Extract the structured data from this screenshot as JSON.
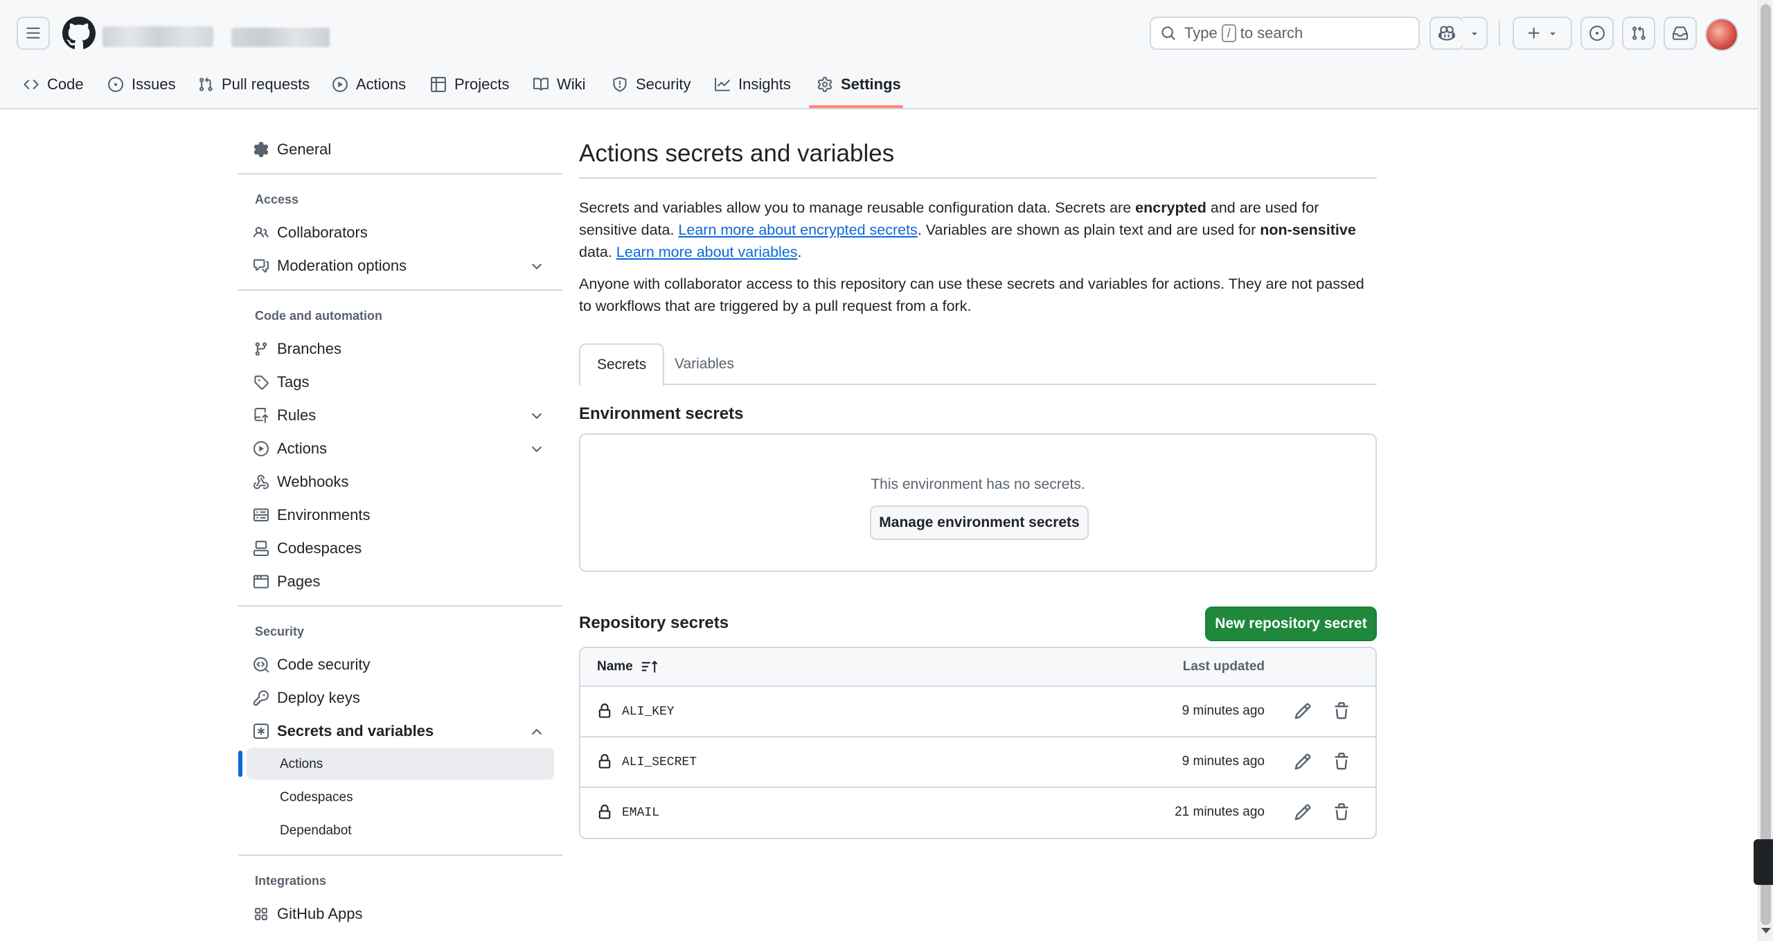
{
  "header": {
    "search_text_before": "Type",
    "search_key": "/",
    "search_text_after": "to search"
  },
  "repo_nav": {
    "items": [
      {
        "label": "Code",
        "icon": "code-icon"
      },
      {
        "label": "Issues",
        "icon": "issue-opened-icon"
      },
      {
        "label": "Pull requests",
        "icon": "git-pull-request-icon"
      },
      {
        "label": "Actions",
        "icon": "play-icon"
      },
      {
        "label": "Projects",
        "icon": "table-icon"
      },
      {
        "label": "Wiki",
        "icon": "book-icon"
      },
      {
        "label": "Security",
        "icon": "shield-icon"
      },
      {
        "label": "Insights",
        "icon": "graph-icon"
      },
      {
        "label": "Settings",
        "icon": "gear-icon",
        "active": true
      }
    ]
  },
  "sidebar": {
    "general": "General",
    "group_access": "Access",
    "collaborators": "Collaborators",
    "moderation": "Moderation options",
    "group_code": "Code and automation",
    "branches": "Branches",
    "tags": "Tags",
    "rules": "Rules",
    "actions": "Actions",
    "webhooks": "Webhooks",
    "environments": "Environments",
    "codespaces": "Codespaces",
    "pages": "Pages",
    "group_security": "Security",
    "code_security": "Code security",
    "deploy_keys": "Deploy keys",
    "secrets_variables": "Secrets and variables",
    "sub_actions": "Actions",
    "sub_codespaces": "Codespaces",
    "sub_dependabot": "Dependabot",
    "group_integrations": "Integrations",
    "github_apps": "GitHub Apps"
  },
  "main": {
    "title": "Actions secrets and variables",
    "p1_a": "Secrets and variables allow you to manage reusable configuration data. Secrets are ",
    "p1_b": "encrypted",
    "p1_c": " and are used for sensitive data. ",
    "p1_link1": "Learn more about encrypted secrets",
    "p1_d": ". Variables are shown as plain text and are used for ",
    "p1_e": "non-sensitive",
    "p1_f": " data. ",
    "p1_link2": "Learn more about variables",
    "p1_g": ".",
    "p2": "Anyone with collaborator access to this repository can use these secrets and variables for actions. They are not passed to workflows that are triggered by a pull request from a fork.",
    "tabs": [
      {
        "label": "Secrets",
        "active": true
      },
      {
        "label": "Variables",
        "active": false
      }
    ],
    "env_title": "Environment secrets",
    "env_empty": "This environment has no secrets.",
    "env_button": "Manage environment secrets",
    "repo_title": "Repository secrets",
    "new_button": "New repository secret",
    "table": {
      "col_name": "Name",
      "col_updated": "Last updated",
      "rows": [
        {
          "name": "ALI_KEY",
          "updated": "9 minutes ago"
        },
        {
          "name": "ALI_SECRET",
          "updated": "9 minutes ago"
        },
        {
          "name": "EMAIL",
          "updated": "21 minutes ago"
        }
      ]
    }
  },
  "colors": {
    "accent": "#0969da",
    "primary_button": "#1f883d",
    "active_tab_underline": "#fd8c73",
    "border": "#d1d9e0",
    "muted_text": "#59636e"
  }
}
